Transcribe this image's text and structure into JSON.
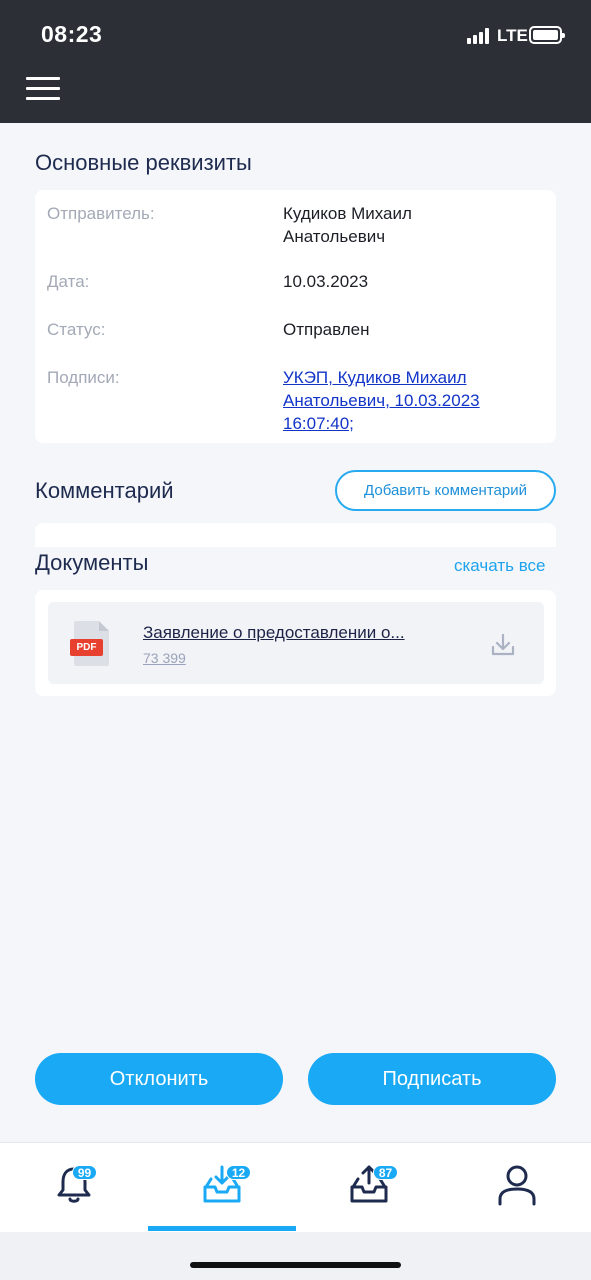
{
  "status_bar": {
    "time": "08:23",
    "network": "LTE"
  },
  "header": {
    "menu_icon": "hamburger-menu-icon"
  },
  "requisites": {
    "title": "Основные реквизиты",
    "rows": [
      {
        "label": "Отправитель:",
        "value": "Кудиков Михаил Анатольевич"
      },
      {
        "label": "Дата:",
        "value": "10.03.2023"
      },
      {
        "label": "Статус:",
        "value": "Отправлен"
      },
      {
        "label": "Подписи:",
        "value": "УКЭП, Кудиков Михаил Анатольевич, 10.03.2023 16:07:40;"
      }
    ]
  },
  "comment": {
    "title": "Комментарий",
    "add_button": "Добавить комментарий"
  },
  "documents": {
    "title": "Документы",
    "download_all": "скачать все",
    "items": [
      {
        "icon": "pdf-file-icon",
        "badge": "PDF",
        "name": "Заявление о предоставлении о...",
        "size": "73 399"
      }
    ]
  },
  "actions": {
    "reject": "Отклонить",
    "sign": "Подписать"
  },
  "tabs": [
    {
      "icon": "bell-icon",
      "badge": "99"
    },
    {
      "icon": "inbox-download-icon",
      "badge": "12",
      "active": true
    },
    {
      "icon": "outbox-upload-icon",
      "badge": "87"
    },
    {
      "icon": "profile-icon"
    }
  ],
  "colors": {
    "accent": "#19a9f5",
    "header_bg": "#2c2f36",
    "link": "#1235c8",
    "pdf_red": "#e8402f"
  }
}
